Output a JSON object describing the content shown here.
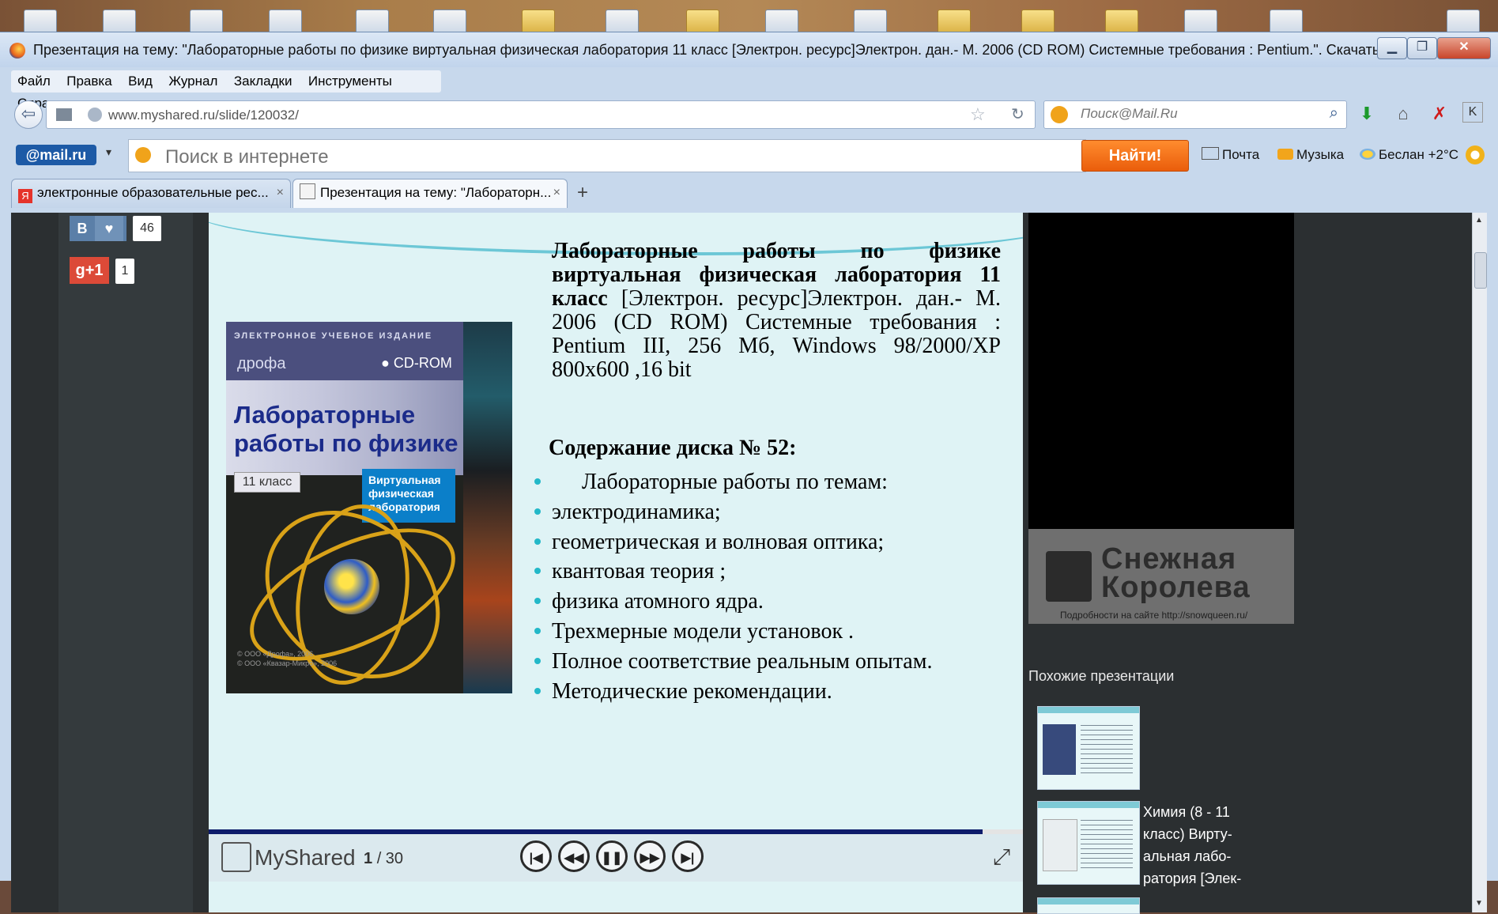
{
  "window": {
    "title": "Презентация на тему: \"Лабораторные работы по физике виртуальная физическая лаборатория 11 класс [Электрон. ресурс]Электрон. дан.- М. 2006 (CD ROM) Системные требования : Pentium.\". Скачать бесплатно и б..."
  },
  "menu": [
    "Файл",
    "Правка",
    "Вид",
    "Журнал",
    "Закладки",
    "Инструменты",
    "Справка"
  ],
  "navbar": {
    "url": "www.myshared.ru/slide/120032/",
    "search_placeholder": "Поиск@Mail.Ru"
  },
  "mailru": {
    "logo": "@mail.ru",
    "search_placeholder": "Поиск в интернете",
    "find_button": "Найти!",
    "mail_link": "Почта",
    "music_link": "Музыка",
    "weather": "Беслан +2°C"
  },
  "tabs": [
    {
      "label": "электронные образовательные рес...",
      "close": "×"
    },
    {
      "label": "Презентация на тему: \"Лабораторн...",
      "close": "×"
    }
  ],
  "new_tab": "+",
  "social": {
    "vk_label": "В",
    "vk_count": "46",
    "gplus_label": "g+1",
    "gplus_count": "1"
  },
  "slide": {
    "cover": {
      "edition": "ЭЛЕКТРОННОЕ УЧЕБНОЕ ИЗДАНИЕ",
      "publisher": "дрофа",
      "cdrom": "● CD-ROM",
      "title": "Лабораторные работы по физике",
      "grade": "11 класс",
      "badge": "Виртуальная физическая лаборатория",
      "copyright": "© ООО «Дрофа», 2006\n© ООО «Квазар-Микро», 2006"
    },
    "heading_bold": "Лабораторные работы по физике виртуальная физическая лаборатория 11 класс",
    "heading_rest": " [Электрон. ресурс]Электрон. дан.- М. 2006 (CD ROM) Системные требования : Pentium III, 256 Мб, Windows 98/2000/XP 800x600 ,16 bit",
    "contents_title": "Содержание диска № 52:",
    "bullets": [
      "Лабораторные работы по темам:",
      "электродинамика;",
      "геометрическая и волновая оптика;",
      "квантовая теория ;",
      "физика атомного ядра.",
      "Трехмерные модели установок .",
      "Полное соответствие реальным опытам.",
      "Методические рекомендации."
    ]
  },
  "player": {
    "brand": "MyShared",
    "page_current": "1",
    "page_total": "/ 30",
    "progress": 0.95
  },
  "ad": {
    "title": "Снежная Королева",
    "note": "Подробности на сайте http://snowqueen.ru/"
  },
  "similar": {
    "title": "Похожие презентации",
    "item2_text": "Химия (8 - 11\nкласс) Вирту-\nальная лабо-\nратория [Элек-"
  }
}
